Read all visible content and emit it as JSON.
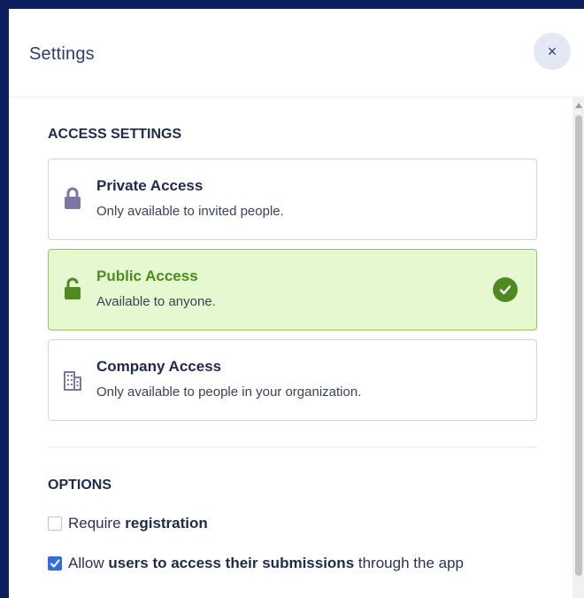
{
  "dialog": {
    "title": "Settings",
    "close_icon": "×"
  },
  "access": {
    "section_title": "ACCESS SETTINGS",
    "options": [
      {
        "name": "Private Access",
        "description": "Only available to invited people.",
        "icon": "lock-icon",
        "selected": false
      },
      {
        "name": "Public Access",
        "description": "Available to anyone.",
        "icon": "unlock-icon",
        "selected": true
      },
      {
        "name": "Company Access",
        "description": "Only available to people in your organization.",
        "icon": "building-icon",
        "selected": false
      }
    ]
  },
  "options": {
    "section_title": "OPTIONS",
    "require_registration": {
      "checked": false,
      "text_1": "Require ",
      "text_2": "registration"
    },
    "allow_access": {
      "checked": true,
      "text_1": "Allow ",
      "text_2": "users to access their submissions",
      "text_3": " through the app"
    }
  },
  "colors": {
    "accent_blue": "#2f6fd6",
    "selected_green": "#4e8a20",
    "selected_bg": "#e6f8d0",
    "frame": "#0b1f5c"
  }
}
